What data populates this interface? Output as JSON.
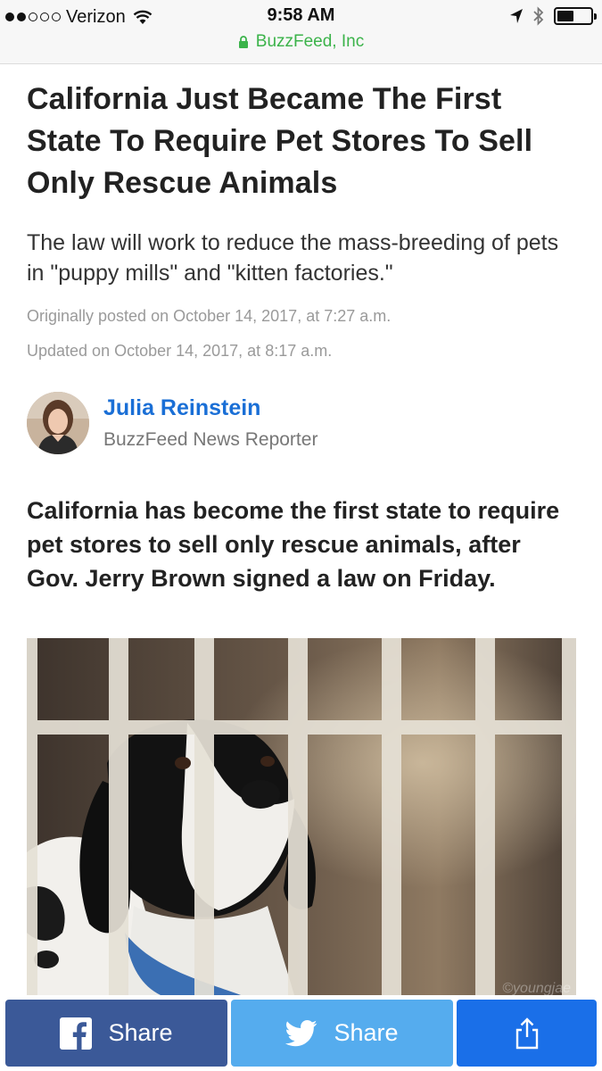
{
  "status_bar": {
    "carrier": "Verizon",
    "time": "9:58 AM",
    "url": "BuzzFeed, Inc"
  },
  "article": {
    "headline": "California Just Became The First State To Require Pet Stores To Sell Only Rescue Animals",
    "dek": "The law will work to reduce the mass-breeding of pets in \"puppy mills\" and \"kitten factories.\"",
    "originally_posted": "Originally posted on October 14, 2017, at 7:27 a.m.",
    "updated": "Updated on October 14, 2017, at 8:17 a.m.",
    "author": {
      "name": "Julia Reinstein",
      "role": "BuzzFeed News Reporter"
    },
    "lede": "California has become the first state to require pet stores to sell only rescue animals, after Gov. Jerry Brown signed a law on Friday.",
    "photo_credit": "©youngjae"
  },
  "share_bar": {
    "facebook_label": "Share",
    "twitter_label": "Share",
    "icons": [
      "facebook-icon",
      "twitter-icon",
      "share-icon"
    ]
  },
  "colors": {
    "facebook": "#3b5998",
    "twitter": "#55acee",
    "share": "#1a6fe8",
    "author_link": "#1a6fd6",
    "secure_url": "#3bb34a"
  }
}
